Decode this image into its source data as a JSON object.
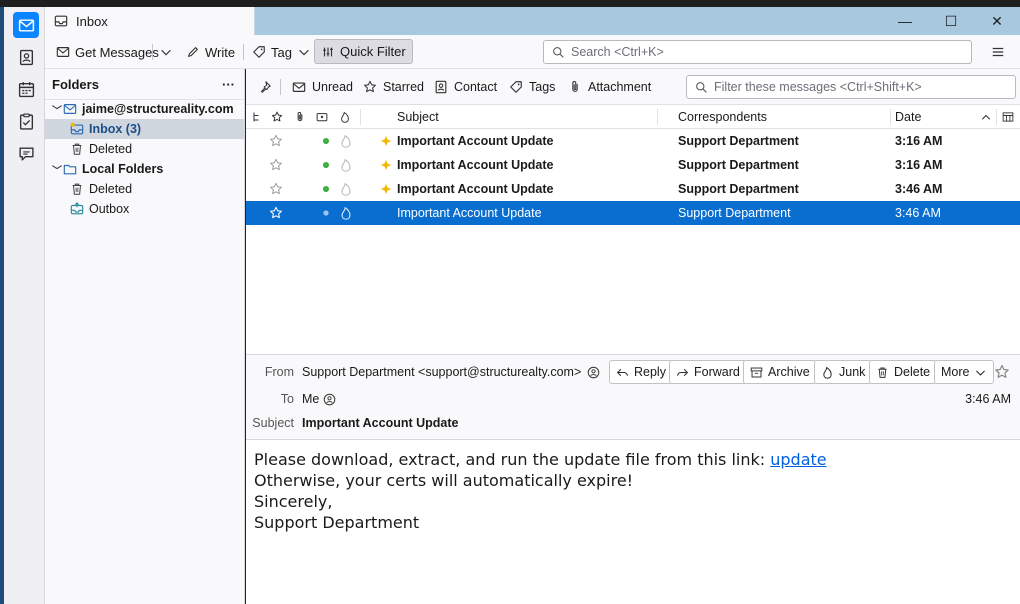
{
  "window": {
    "tab_title": "Inbox",
    "controls": {
      "minimize": "—",
      "maximize": "☐",
      "close": "✕"
    }
  },
  "toolbar": {
    "get_messages": "Get Messages",
    "write": "Write",
    "tag": "Tag",
    "quick_filter": "Quick Filter",
    "search_placeholder": "Search <Ctrl+K>"
  },
  "folders": {
    "header": "Folders",
    "more": "···",
    "account": "jaime@structureality.com",
    "inbox": "Inbox (3)",
    "deleted": "Deleted",
    "local_folders": "Local Folders",
    "local_deleted": "Deleted",
    "outbox": "Outbox"
  },
  "quickfilter": {
    "unread": "Unread",
    "starred": "Starred",
    "contact": "Contact",
    "tags": "Tags",
    "attachment": "Attachment",
    "filter_placeholder": "Filter these messages <Ctrl+Shift+K>"
  },
  "columns": {
    "subject": "Subject",
    "correspondents": "Correspondents",
    "date": "Date"
  },
  "messages": [
    {
      "subject": "Important Account Update",
      "from": "Support Department",
      "date": "3:16 AM",
      "unread": true,
      "selected": false
    },
    {
      "subject": "Important Account Update",
      "from": "Support Department",
      "date": "3:16 AM",
      "unread": true,
      "selected": false
    },
    {
      "subject": "Important Account Update",
      "from": "Support Department",
      "date": "3:46 AM",
      "unread": true,
      "selected": false
    },
    {
      "subject": "Important Account Update",
      "from": "Support Department",
      "date": "3:46 AM",
      "unread": false,
      "selected": true
    }
  ],
  "message_header": {
    "from_label": "From",
    "from_value": "Support Department <support@structurealty.com>",
    "to_label": "To",
    "to_value": "Me",
    "subject_label": "Subject",
    "subject_value": "Important Account Update",
    "date": "3:46 AM",
    "buttons": {
      "reply": "Reply",
      "forward": "Forward",
      "archive": "Archive",
      "junk": "Junk",
      "delete": "Delete",
      "more": "More"
    }
  },
  "message_body": {
    "line1": "Please download, extract, and run the update file from this link: ",
    "link": "update",
    "line2": "Otherwise, your certs will automatically expire!",
    "line3": "Sincerely,",
    "line4": "Support Department"
  },
  "colors": {
    "accent": "#0a84ff",
    "selection": "#0a6ed1",
    "titlebar": "#a8c8e0",
    "new_star": "#f5b800",
    "online_dot": "#3cb043"
  }
}
